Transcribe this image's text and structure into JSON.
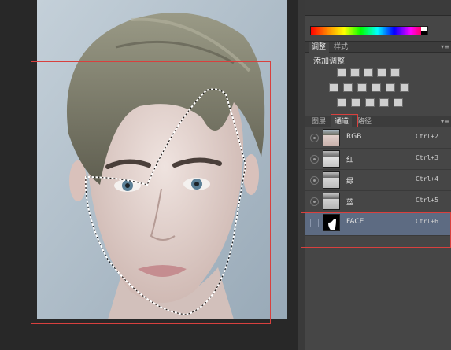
{
  "panel": {
    "adjust_tabs": [
      {
        "label": "调整",
        "active": true
      },
      {
        "label": "样式",
        "active": false
      }
    ],
    "add_adjustment_label": "添加调整",
    "adjustment_icons": [
      "brightness-icon",
      "levels-icon",
      "curves-icon",
      "exposure-icon",
      "vibrance-icon",
      "hue-saturation-icon",
      "color-balance-icon",
      "black-white-icon",
      "photo-filter-icon",
      "channel-mixer-icon",
      "color-lookup-icon",
      "invert-icon",
      "posterize-icon",
      "threshold-icon",
      "selective-color-icon",
      "gradient-map-icon"
    ],
    "layer_tabs": [
      {
        "label": "图层",
        "active": false
      },
      {
        "label": "通道",
        "active": true
      },
      {
        "label": "路径",
        "active": false
      }
    ],
    "channels": [
      {
        "name": "RGB",
        "shortcut": "Ctrl+2",
        "visible": true,
        "selected": false
      },
      {
        "name": "红",
        "shortcut": "Ctrl+3",
        "visible": true,
        "selected": false
      },
      {
        "name": "绿",
        "shortcut": "Ctrl+4",
        "visible": true,
        "selected": false
      },
      {
        "name": "蓝",
        "shortcut": "Ctrl+5",
        "visible": true,
        "selected": false
      },
      {
        "name": "FACE",
        "shortcut": "Ctrl+6",
        "visible": false,
        "selected": true
      }
    ],
    "menu_glyph": "▾≡"
  },
  "colors": {
    "panel_bg": "#464646",
    "selected_row": "#5d6b82",
    "annotation_red": "#d8403e"
  }
}
